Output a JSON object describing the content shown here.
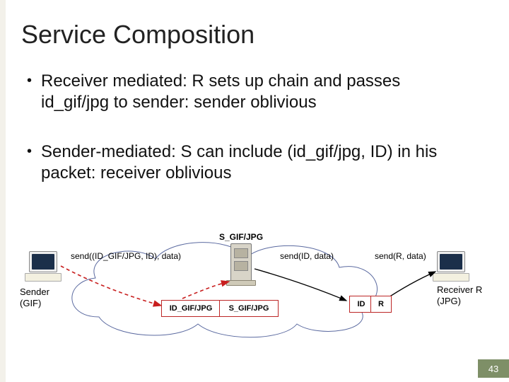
{
  "title": "Service Composition",
  "bullets": [
    "Receiver mediated: R sets up chain and passes id_gif/jpg to sender: sender oblivious",
    "Sender-mediated: S can include (id_gif/jpg, ID) in his packet: receiver oblivious"
  ],
  "diagram": {
    "service_label": "S_GIF/JPG",
    "msg_send_full": "send((ID_GIF/JPG, ID), data)",
    "msg_send_id": "send(ID, data)",
    "msg_send_r": "send(R, data)",
    "sender_label_l1": "Sender",
    "sender_label_l2": "(GIF)",
    "receiver_label_l1": "Receiver R",
    "receiver_label_l2": "(JPG)",
    "hop_id_gif": "ID_GIF/JPG",
    "hop_s_gif": "S_GIF/JPG",
    "hop_id": "ID",
    "hop_r": "R"
  },
  "page_number": "43"
}
